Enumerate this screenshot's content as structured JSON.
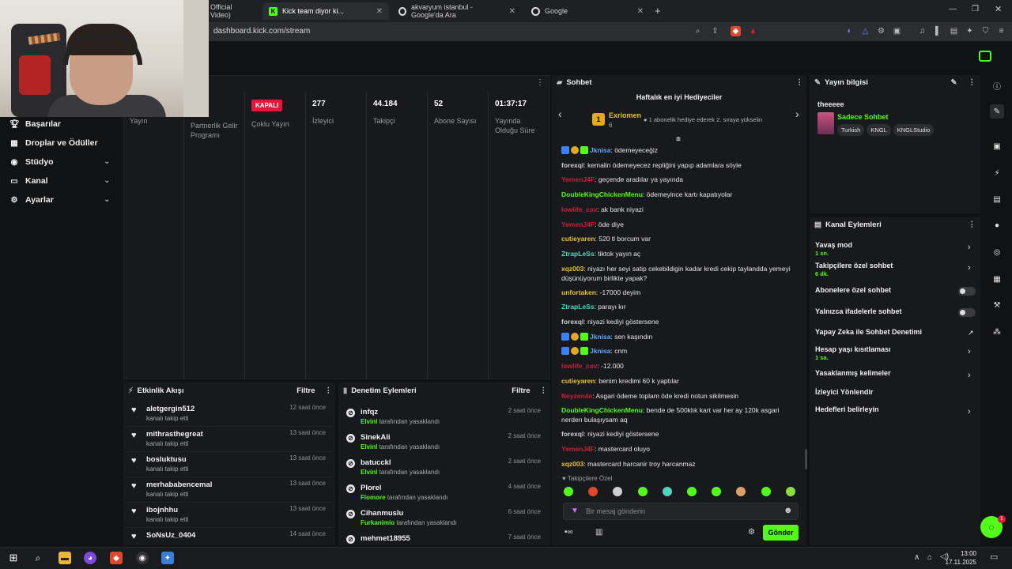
{
  "browser": {
    "tabs": [
      {
        "label": "Official Video)",
        "active": false
      },
      {
        "label": "Kick team diyor ki...",
        "active": true
      },
      {
        "label": "akvaryum istanbul - Google'da Ara",
        "active": false
      },
      {
        "label": "Google",
        "active": false
      }
    ],
    "url": "dashboard.kick.com/stream"
  },
  "nav": {
    "items": [
      {
        "label": "Başarılar",
        "icon": "trophy-icon"
      },
      {
        "label": "Droplar ve Ödüller",
        "icon": "gift-icon"
      },
      {
        "label": "Stüdyo",
        "icon": "studio-icon"
      },
      {
        "label": "Kanal",
        "icon": "channel-icon"
      },
      {
        "label": "Ayarlar",
        "icon": "gear-icon"
      }
    ]
  },
  "stats": [
    {
      "value": "",
      "label": "Yayın"
    },
    {
      "value": "",
      "label": "Partnerlik Gelir Programı"
    },
    {
      "value": "KAPALI",
      "label": "Çoklu Yayın"
    },
    {
      "value": "277",
      "label": "İzleyici"
    },
    {
      "value": "44.184",
      "label": "Takipçi"
    },
    {
      "value": "52",
      "label": "Abone Sayısı"
    },
    {
      "value": "01:37:17",
      "label": "Yayında Olduğu Süre"
    }
  ],
  "activity": {
    "title": "Etkinlik Akışı",
    "filter": "Filtre",
    "items": [
      {
        "name": "aletgergin512",
        "action": "kanalı takip etti",
        "time": "12 saat önce"
      },
      {
        "name": "mithrasthegreat",
        "action": "kanalı takip etti",
        "time": "13 saat önce"
      },
      {
        "name": "bosluktusu",
        "action": "kanalı takip etti",
        "time": "13 saat önce"
      },
      {
        "name": "merhababen‌cemal",
        "action": "kanalı takip etti",
        "time": "13 saat önce"
      },
      {
        "name": "ibojnhhu",
        "action": "kanalı takip etti",
        "time": "13 saat önce"
      },
      {
        "name": "SoNsUz_0404",
        "action": "",
        "time": "14 saat önce"
      }
    ]
  },
  "moderation": {
    "title": "Denetim Eylemleri",
    "filter": "Filtre",
    "items": [
      {
        "name": "infqz",
        "mod": "Elvinl",
        "action": "tarafından yasaklandı",
        "time": "2 saat önce"
      },
      {
        "name": "SinekAli",
        "mod": "Elvinl",
        "action": "tarafından yasaklandı",
        "time": "2 saat önce"
      },
      {
        "name": "batucckl",
        "mod": "Elvinl",
        "action": "tarafından yasaklandı",
        "time": "2 saat önce"
      },
      {
        "name": "Plorel",
        "mod": "Flomore",
        "action": "tarafından yasaklandı",
        "time": "4 saat önce"
      },
      {
        "name": "Cihanmuslu",
        "mod": "Furkanimio",
        "action": "tarafından yasaklandı",
        "time": "6 saat önce"
      },
      {
        "name": "mehmet18955",
        "mod": "",
        "action": "",
        "time": "7 saat önce"
      }
    ]
  },
  "chat": {
    "title": "Sohbet",
    "gifters_title": "Haftalık en iyi Hediyeciler",
    "top_gifter": "Exriomen",
    "top_gifter_count": "6",
    "gift_hint": "1 abonelik hediye ederek 2. sıraya yükselin",
    "messages": [
      {
        "user": "Jknisa",
        "color": "#5fa8ff",
        "text": ": ödemeyeceğiz",
        "badges": true
      },
      {
        "user": "forexql",
        "color": "#cfcfcf",
        "text": ": kemalin ödemeyecez repliğini yapıp adamlara söyle"
      },
      {
        "user": "YemenJ4F",
        "color": "#c8223a",
        "text": ": geçende aradılar ya yayında"
      },
      {
        "user": "DoubleKingChickenMenu",
        "color": "#53fc18",
        "text": ": ödemeyince kartı kapatıyolar"
      },
      {
        "user": "lowlife_cav",
        "color": "#c8223a",
        "text": ": ak bank niyazi"
      },
      {
        "user": "YemenJ4F",
        "color": "#c8223a",
        "text": ": öde diye"
      },
      {
        "user": "cutieyaren",
        "color": "#e6c23a",
        "text": ": 520 tl borcum var"
      },
      {
        "user": "ZtrapLeSs",
        "color": "#4fd6c0",
        "text": ": tiktok yayın aç"
      },
      {
        "user": "xqz003",
        "color": "#e6c23a",
        "text": ": niyazı her seyi satip cekebildigin kadar kredi cekip taylandda yemeyi düşünüyorum birlikte yapak?"
      },
      {
        "user": "unfortaken",
        "color": "#e6c23a",
        "text": ": -17000 deyim"
      },
      {
        "user": "ZtrapLeSs",
        "color": "#4fd6c0",
        "text": ": parayı kır"
      },
      {
        "user": "forexql",
        "color": "#cfcfcf",
        "text": ": niyazi kediyi göstersene"
      },
      {
        "user": "Jknisa",
        "color": "#5fa8ff",
        "text": ": sen kaşındın",
        "badges": true
      },
      {
        "user": "Jknisa",
        "color": "#5fa8ff",
        "text": ": cnm",
        "badges": true
      },
      {
        "user": "lowlife_cav",
        "color": "#c8223a",
        "text": ": -12.000"
      },
      {
        "user": "cutieyaren",
        "color": "#e6c23a",
        "text": ": benim kredimi 60 k yaptılar"
      },
      {
        "user": "Neyzen4e",
        "color": "#c8223a",
        "text": ": Asgari ödeme toplam öde kredi notun sikilmesin"
      },
      {
        "user": "DoubleKingChickenMenu",
        "color": "#53fc18",
        "text": ": bende de 500klık kart var her ay 120k asgari nerden bulaşıysam aq"
      },
      {
        "user": "forexql",
        "color": "#cfcfcf",
        "text": ": niyazi kediyi göstersene"
      },
      {
        "user": "YemenJ4F",
        "color": "#c8223a",
        "text": ": mastercard oluyo"
      },
      {
        "user": "xqz003",
        "color": "#e6c23a",
        "text": ": mastercard harcanir troy harcanmaz"
      }
    ],
    "followers_only": "Takipçilere Özel",
    "input_placeholder": "Bir mesaj gönderin",
    "send": "Gönder"
  },
  "info": {
    "title": "Yayın bilgisi",
    "stream_title": "theeeee",
    "category": "Sadece Sohbet",
    "tags": [
      "Turkish",
      "KNGL",
      "KNGLStudio"
    ]
  },
  "actions": {
    "title": "Kanal Eylemleri",
    "items": [
      {
        "label": "Yavaş mod",
        "sub": "1 sn.",
        "kind": "chevron"
      },
      {
        "label": "Takipçilere özel sohbet",
        "sub": "6 dk.",
        "kind": "chevron"
      },
      {
        "label": "Abonelere özel sohbet",
        "sub": "",
        "kind": "toggle"
      },
      {
        "label": "Yalnızca ifadelerle sohbet",
        "sub": "",
        "kind": "toggle"
      },
      {
        "label": "Yapay Zeka ile Sohbet Denetimi",
        "sub": "",
        "kind": "external"
      },
      {
        "label": "Hesap yaşı kısıtlaması",
        "sub": "1 sa.",
        "kind": "chevron"
      },
      {
        "label": "Yasaklanmış kelimeler",
        "sub": "",
        "kind": "chevron"
      },
      {
        "label": "İzleyici Yönlendir",
        "sub": "",
        "kind": "none"
      },
      {
        "label": "Hedefleri belirleyin",
        "sub": "",
        "kind": "chevron"
      }
    ]
  },
  "taskbar": {
    "time": "13:00",
    "date": "17.11.2025"
  },
  "colors": {
    "accent": "#53fc18",
    "panel": "#18191c",
    "bg": "#111214"
  }
}
